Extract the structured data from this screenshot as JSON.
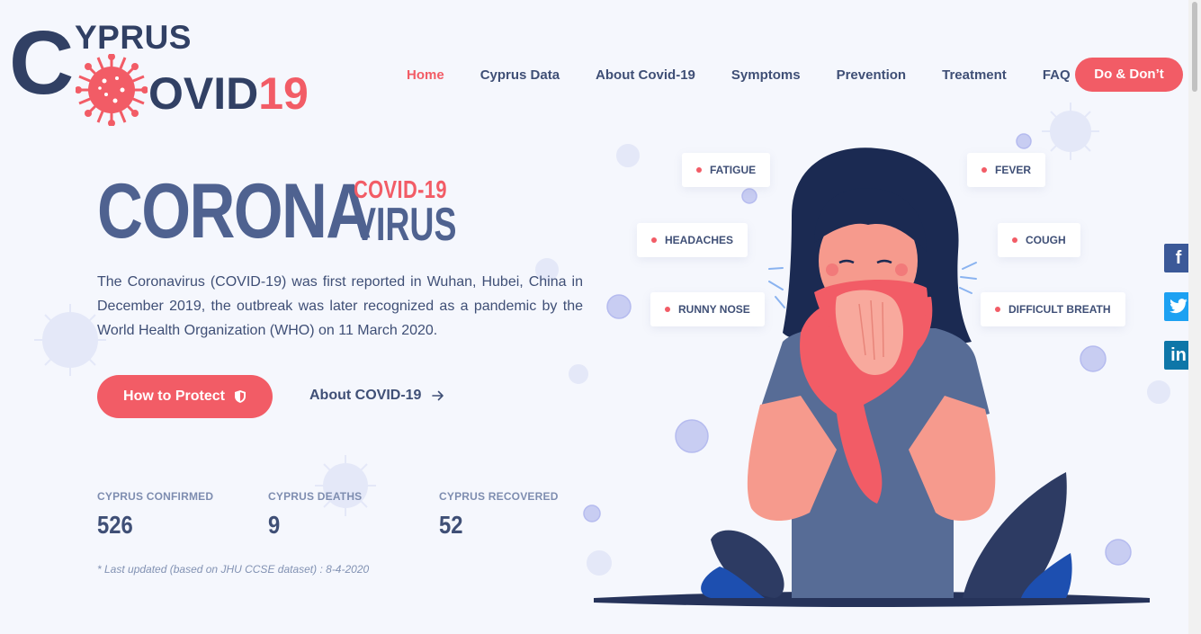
{
  "brand": {
    "c": "C",
    "yprus": "YPRUS",
    "ovid": "OVID",
    "num": "19"
  },
  "nav": {
    "items": [
      "Home",
      "Cyprus Data",
      "About Covid-19",
      "Symptoms",
      "Prevention",
      "Treatment",
      "FAQ"
    ],
    "cta": "Do & Don’t"
  },
  "hero": {
    "corona": "CORONA",
    "covid_tag": "COVID-19",
    "virus": "VIRUS",
    "intro": "The Coronavirus (COVID-19) was first reported in Wuhan, Hubei, China in December 2019, the outbreak was later recognized as a pandemic by the World Health Organization (WHO) on 11 March 2020.",
    "protect_label": "How to Protect",
    "about_label": "About COVID-19"
  },
  "stats": [
    {
      "label": "CYPRUS CONFIRMED",
      "value": "526"
    },
    {
      "label": "CYPRUS DEATHS",
      "value": "9"
    },
    {
      "label": "CYPRUS RECOVERED",
      "value": "52"
    }
  ],
  "note": "* Last updated (based on JHU CCSE dataset) : 8-4-2020",
  "symptoms": [
    "FATIGUE",
    "FEVER",
    "HEADACHES",
    "COUGH",
    "RUNNY NOSE",
    "DIFFICULT BREATH"
  ],
  "social": {
    "facebook": "f",
    "twitter": "twitter-bird-icon",
    "linkedin": "in"
  },
  "colors": {
    "accent": "#f25c66",
    "primary": "#3f4f76",
    "background": "#f5f7fd"
  }
}
